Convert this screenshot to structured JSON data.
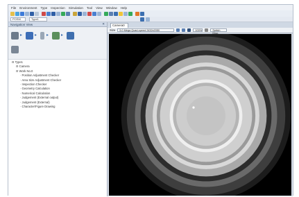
{
  "menu": [
    "File",
    "Environment",
    "Type",
    "Inspection",
    "Simulation",
    "Tool",
    "View",
    "Window",
    "Help"
  ],
  "toolbar_colors": [
    "#e5c04a",
    "#4aa3df",
    "#3d7bd9",
    "#9bb5d6",
    "#2f5fa6",
    "#b9c7d8",
    "#d04a4a",
    "#4a7fcf",
    "#2f5fa6",
    "#9bb5d6",
    "#35aa5a",
    "#5a7fb2",
    "#c9a53b",
    "#2f5fa6",
    "#9bb5d6",
    "#d04a4a",
    "#4a7fcf",
    "#9bb5d6",
    "#35aa5a",
    "#5a7fb2",
    "#3c6fb0",
    "#f0c53b",
    "#9bb5d6",
    "#35aa5a",
    "#e2772a",
    "#3c6fb0"
  ],
  "toolbar2": {
    "field1": "POSM",
    "field2": "Type1"
  },
  "nav_panel": {
    "title": "Navigation View",
    "close_glyph": "✕"
  },
  "tree": [
    {
      "label": "Type1",
      "level": 0
    },
    {
      "label": "Camera",
      "level": 1
    },
    {
      "label": "Work No.0",
      "level": 1
    },
    {
      "label": "Position Adjustment Checker",
      "level": 2
    },
    {
      "label": "Area Size Adjustment Checker",
      "level": 2
    },
    {
      "label": "Inspection Checker",
      "level": 2
    },
    {
      "label": "Geometry Calculation",
      "level": 2
    },
    {
      "label": "Numerical Calculation",
      "level": 2
    },
    {
      "label": "Judgement (External output)",
      "level": 2
    },
    {
      "label": "Judgement (External)",
      "level": 2
    },
    {
      "label": "Character/Figure Drawing",
      "level": 2
    }
  ],
  "tab": {
    "label": "Camera0"
  },
  "camera_bar": {
    "label": "Size",
    "size_value": "5.0 Mega Quad-speed 2432x2050",
    "zoom": "100%",
    "button": "Switch Disp."
  },
  "rings": [
    {
      "r": 0.525,
      "fill": "#1c1c1c"
    },
    {
      "r": 0.49,
      "fill": "#3e3e3e"
    },
    {
      "r": 0.44,
      "fill": "#6a6a6a"
    },
    {
      "r": 0.405,
      "fill": "#2c2c2c"
    },
    {
      "r": 0.375,
      "fill": "#a9a9a9"
    },
    {
      "r": 0.33,
      "fill": "#d9d9d9"
    },
    {
      "r": 0.305,
      "fill": "#9a9a9a"
    },
    {
      "r": 0.285,
      "fill": "#cfcfcf"
    },
    {
      "r": 0.225,
      "fill": "#efefef"
    },
    {
      "r": 0.205,
      "fill": "#b5b5b5"
    },
    {
      "r": 0.185,
      "fill": "#cdcdcd"
    },
    {
      "r": 0.12,
      "fill": "#c4c4c4"
    }
  ]
}
